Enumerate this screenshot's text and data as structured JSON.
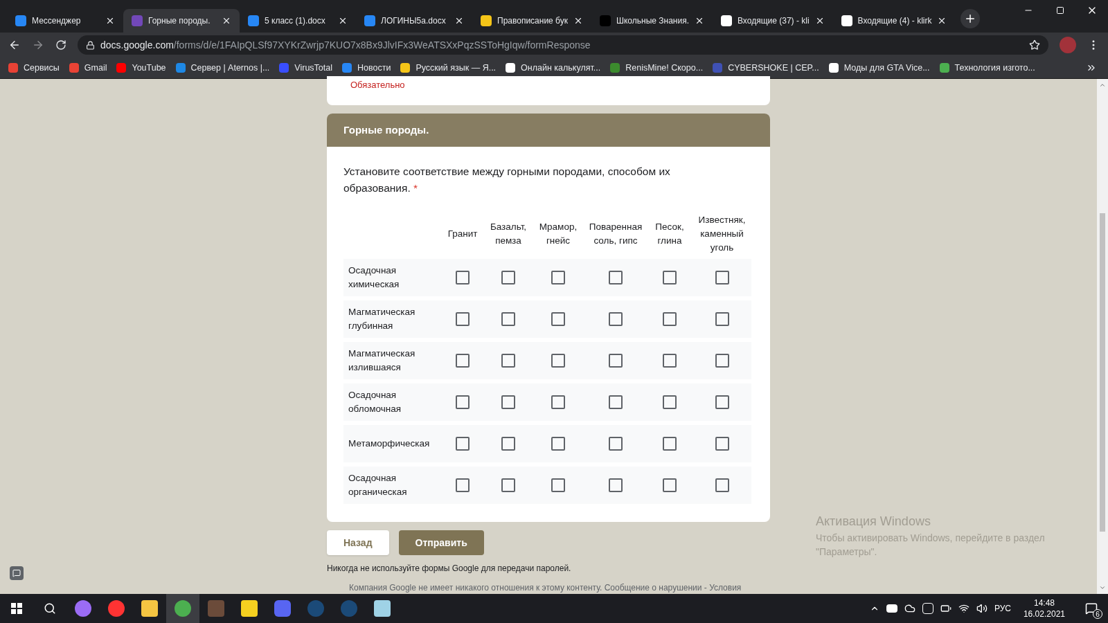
{
  "browser": {
    "tabs": [
      {
        "title": "Мессенджер",
        "selected": false
      },
      {
        "title": "Горные породы.",
        "selected": true
      },
      {
        "title": "5 класс (1).docx",
        "selected": false
      },
      {
        "title": "ЛОГИНЫ5а.docx",
        "selected": false
      },
      {
        "title": "Правописание бук",
        "selected": false
      },
      {
        "title": "Школьные Знания.",
        "selected": false
      },
      {
        "title": "Входящие (37) - kli",
        "selected": false
      },
      {
        "title": "Входящие (4) - klirk",
        "selected": false
      }
    ],
    "address": {
      "domain": "docs.google.com",
      "path": "/forms/d/e/1FAIpQLSf97XYKrZwrjp7KUO7x8Bx9JlvIFx3WeATSXxPqzSSToHgIqw/formResponse"
    },
    "bookmarks": [
      "Сервисы",
      "Gmail",
      "YouTube",
      "Сервер | Aternos |...",
      "VirusTotal",
      "Новости",
      "Русский язык — Я...",
      "Онлайн калькулят...",
      "RenisMine! Скоро...",
      "CYBERSHOKE | CEP...",
      "Моды для GTA Vice...",
      "Технология изгото..."
    ]
  },
  "form": {
    "required_note": "Обязательно",
    "section_title": "Горные породы.",
    "question": {
      "text": "Установите соответствие между горными породами, способом их образования.",
      "required_mark": "*"
    },
    "columns": [
      "Гранит",
      "Базальт, пемза",
      "Мрамор, гнейс",
      "Поваренная соль, гипс",
      "Песок, глина",
      "Известняк, каменный уголь"
    ],
    "rows": [
      {
        "label": "Осадочная химическая",
        "cells": [
          {
            "checked": false
          },
          {
            "checked": false
          },
          {
            "checked": false
          },
          {
            "checked": false
          },
          {
            "checked": false
          },
          {
            "checked": false
          }
        ]
      },
      {
        "label": "Магматическая глубинная",
        "cells": [
          {
            "checked": false
          },
          {
            "checked": false
          },
          {
            "checked": false
          },
          {
            "checked": false
          },
          {
            "checked": false
          },
          {
            "checked": false
          }
        ]
      },
      {
        "label": "Магматическая излившаяся",
        "cells": [
          {
            "checked": false
          },
          {
            "checked": false
          },
          {
            "checked": false
          },
          {
            "checked": false
          },
          {
            "checked": false
          },
          {
            "checked": false
          }
        ]
      },
      {
        "label": "Осадочная обломочная",
        "cells": [
          {
            "checked": false
          },
          {
            "checked": false
          },
          {
            "checked": false
          },
          {
            "checked": false
          },
          {
            "checked": false
          },
          {
            "checked": false
          }
        ]
      },
      {
        "label": "Метаморфическая",
        "cells": [
          {
            "checked": false
          },
          {
            "checked": false
          },
          {
            "checked": false
          },
          {
            "checked": false
          },
          {
            "checked": false
          },
          {
            "checked": false
          }
        ]
      },
      {
        "label": "Осадочная органическая",
        "cells": [
          {
            "checked": false
          },
          {
            "checked": false
          },
          {
            "checked": false
          },
          {
            "checked": false
          },
          {
            "checked": false
          },
          {
            "checked": false
          }
        ]
      }
    ],
    "buttons": [
      {
        "label": "Назад",
        "kind": "secondary"
      },
      {
        "label": "Отправить",
        "kind": "primary"
      }
    ],
    "password_warning": "Никогда не используйте формы Google для передачи паролей.",
    "disclaimer": "Компания Google не имеет никакого отношения к этому контенту. Сообщение о нарушении - Условия"
  },
  "windows_activation": {
    "title": "Активация Windows",
    "text": "Чтобы активировать Windows, перейдите в раздел \"Параметры\"."
  },
  "taskbar": {
    "language": "РУС",
    "time": "14:48",
    "date": "16.02.2021",
    "notifications": "6"
  }
}
